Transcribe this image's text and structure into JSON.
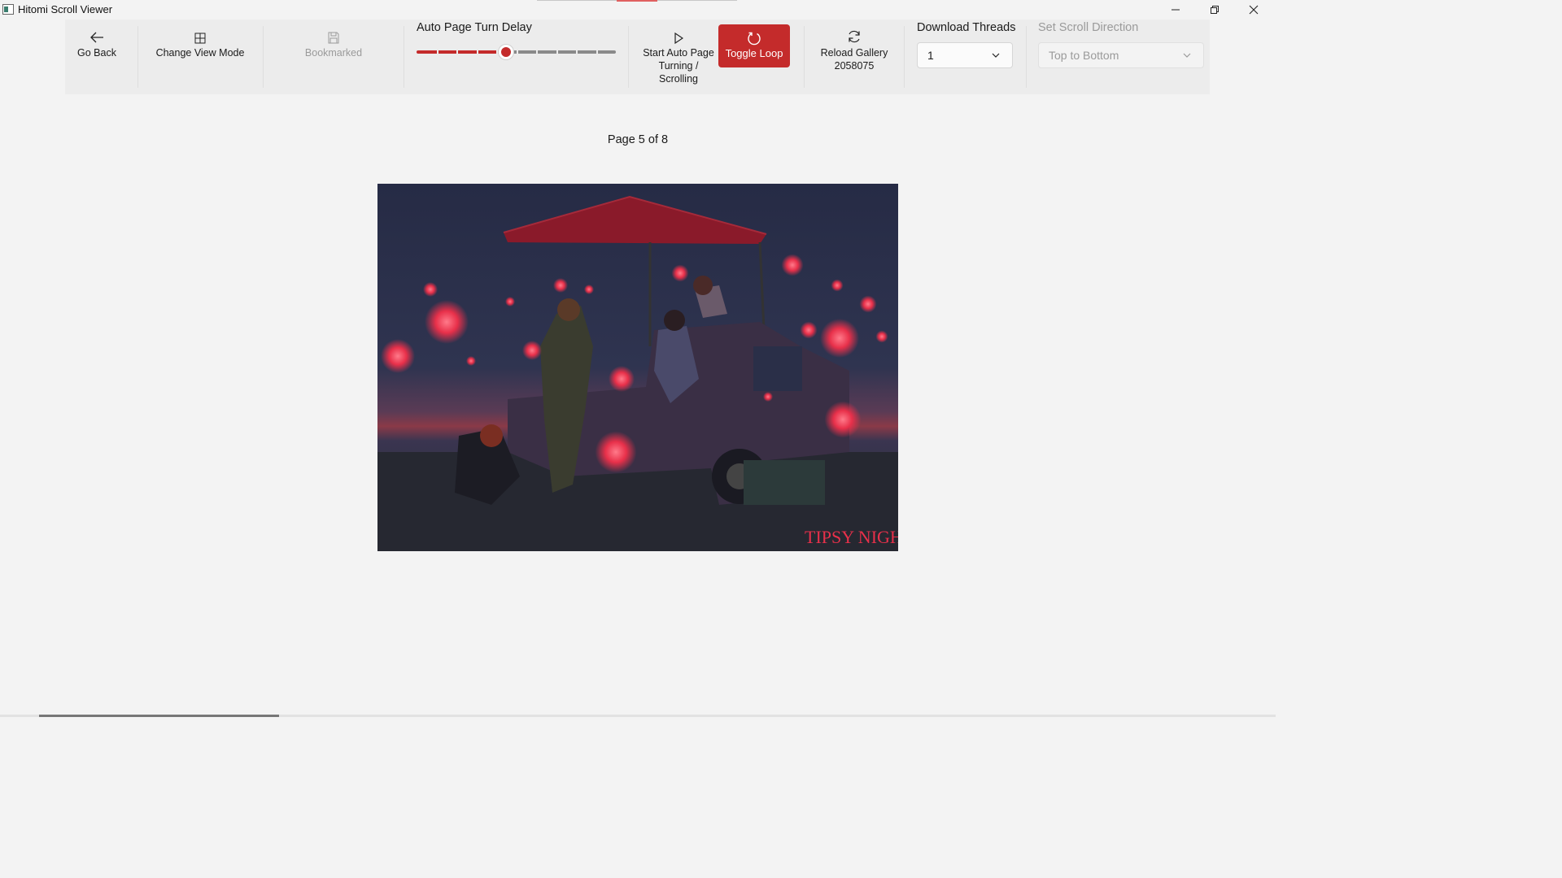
{
  "window": {
    "title": "Hitomi Scroll Viewer",
    "minimize_icon": "minimize-icon",
    "maximize_icon": "restore-icon",
    "close_icon": "close-icon"
  },
  "toolbar": {
    "go_back": {
      "label": "Go Back",
      "icon": "arrow-left-icon"
    },
    "change_view": {
      "label": "Change View Mode",
      "icon": "grid-icon"
    },
    "bookmarked": {
      "label": "Bookmarked",
      "icon": "save-icon",
      "enabled": false
    },
    "auto_delay": {
      "label": "Auto Page Turn Delay",
      "value_fraction": 0.45,
      "accent": "#c42b2b"
    },
    "start_auto": {
      "label_line1": "Start Auto Page",
      "label_line2": "Turning /",
      "label_line3": "Scrolling",
      "icon": "play-icon"
    },
    "toggle_loop": {
      "label": "Toggle Loop",
      "icon": "loop-icon",
      "active": true,
      "color": "#c42b2b"
    },
    "reload": {
      "label_line1": "Reload Gallery",
      "label_line2": "2058075",
      "icon": "refresh-icon"
    },
    "download_threads": {
      "label": "Download Threads",
      "value": "1"
    },
    "scroll_direction": {
      "label": "Set Scroll Direction",
      "value": "Top to Bottom",
      "enabled": false
    }
  },
  "viewer": {
    "page_indicator": "Page 5 of 8",
    "image": {
      "watermark": "TIPSY NIGHT",
      "palette": {
        "sky": "#2a2f48",
        "glow": "#e8304a",
        "canopy": "#8a1a2a"
      }
    }
  }
}
